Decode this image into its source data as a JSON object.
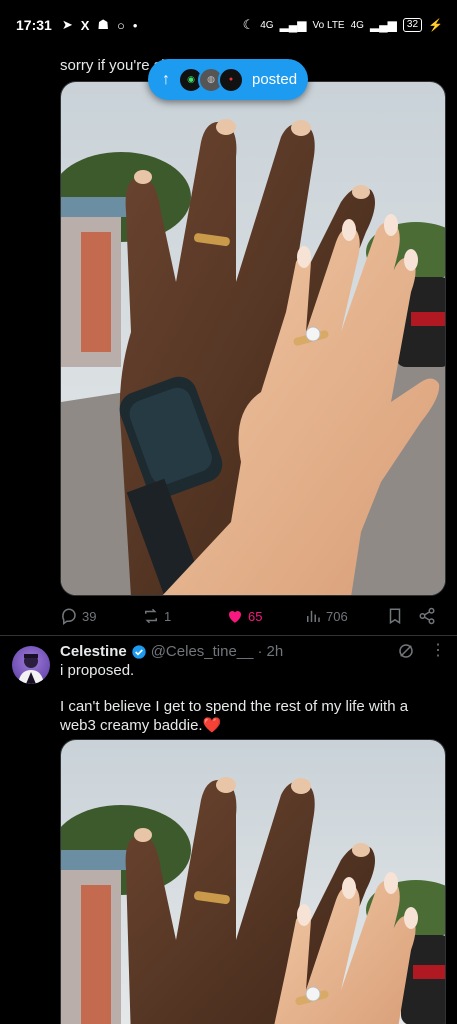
{
  "status_bar": {
    "time": "17:31",
    "left_icons": [
      "navigation-arrow-icon",
      "x-logo-icon",
      "snapchat-icon",
      "circle-icon",
      "dot-icon"
    ],
    "network1": "4G",
    "network2": "Vo LTE",
    "network3": "4G",
    "battery": "32"
  },
  "tweet1": {
    "text_fragment": "sorry if you're sir",
    "posted_pill": {
      "label": "posted"
    },
    "actions": {
      "replies": "39",
      "reposts": "1",
      "likes": "65",
      "views": "706"
    }
  },
  "tweet2": {
    "display_name": "Celestine",
    "handle": "@Celes_tine__",
    "time": "2h",
    "line1": "i proposed.",
    "body": "I can't believe I get to spend the rest of my life with a web3 creamy baddie.❤️"
  },
  "colors": {
    "background": "#000000",
    "accent": "#1d9bf0",
    "like": "#f91880",
    "muted": "#71767b",
    "text": "#e7e9ea"
  }
}
